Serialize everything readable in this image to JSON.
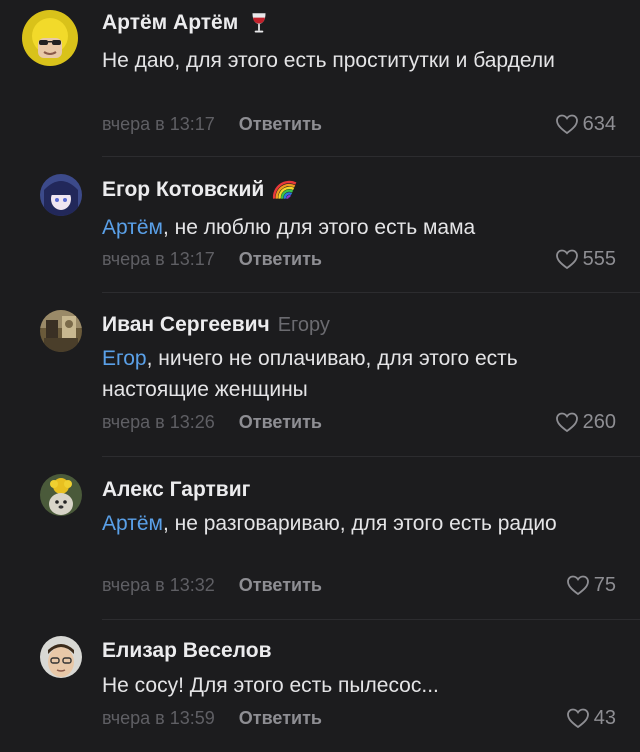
{
  "colors": {
    "background": "#1c1c1e",
    "mention": "#5aa0e8",
    "muted": "#5f5f64",
    "action": "#8e8e93"
  },
  "comments": [
    {
      "author": "Артём Артём",
      "emoji_icon": "wine-glass-icon",
      "text": "Не даю, для этого есть проститутки и бардели",
      "time": "вчера в 13:17",
      "reply_label": "Ответить",
      "likes": "634"
    },
    {
      "author": "Егор Котовский",
      "emoji_icon": "rainbow-icon",
      "mention": "Артём",
      "text": ", не люблю для этого есть мама",
      "time": "вчера в 13:17",
      "reply_label": "Ответить",
      "likes": "555"
    },
    {
      "author": "Иван Сергеевич",
      "reply_to": "Егору",
      "mention": "Егор",
      "text": ", ничего не оплачиваю, для этого есть настоящие женщины",
      "time": "вчера в 13:26",
      "reply_label": "Ответить",
      "likes": "260"
    },
    {
      "author": "Алекс Гартвиг",
      "mention": "Артём",
      "text": ", не разговариваю, для этого есть радио",
      "time": "вчера в 13:32",
      "reply_label": "Ответить",
      "likes": "75"
    },
    {
      "author": "Елизар Веселов",
      "text": "Не сосу! Для этого есть пылесос...",
      "time": "вчера в 13:59",
      "reply_label": "Ответить",
      "likes": "43"
    }
  ]
}
